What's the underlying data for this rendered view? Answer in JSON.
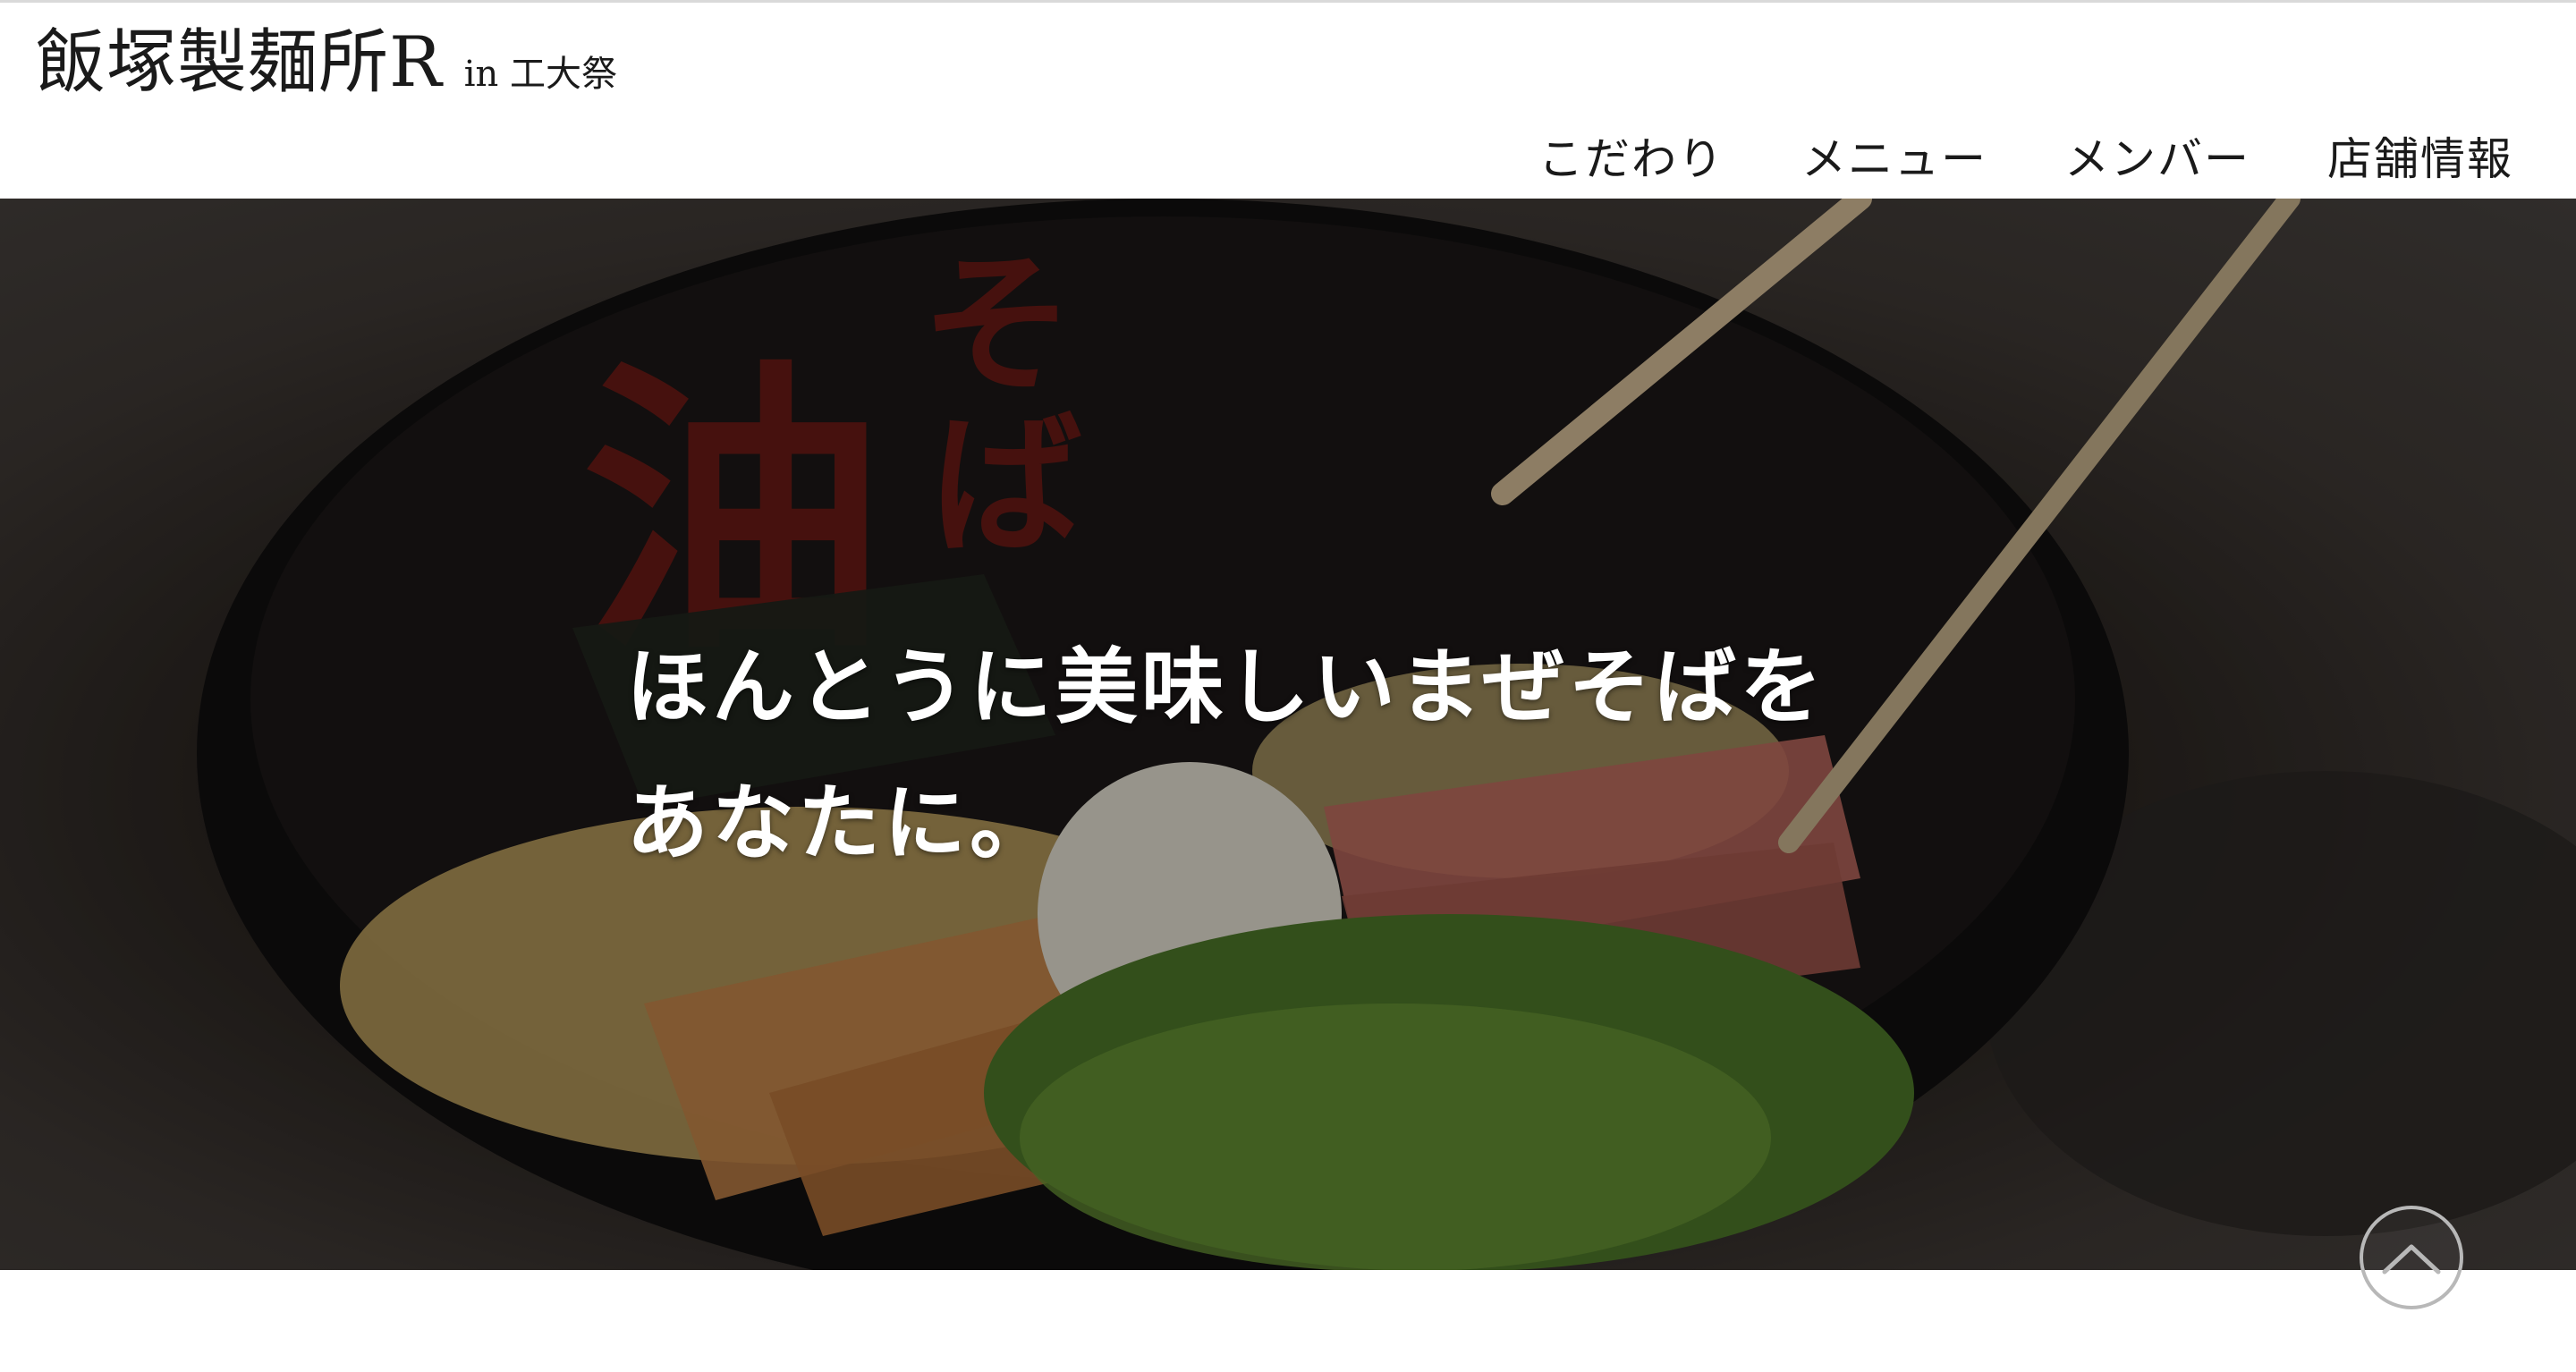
{
  "header": {
    "brand_name": "飯塚製麺所R",
    "brand_sub": "in 工大祭"
  },
  "nav": {
    "items": [
      {
        "label": "こだわり"
      },
      {
        "label": "メニュー"
      },
      {
        "label": "メンバー"
      },
      {
        "label": "店舗情報"
      }
    ]
  },
  "hero": {
    "line1": "ほんとうに美味しいまぜそばを",
    "line2": "あなたに。",
    "image_subject": "mazesoba bowl photo"
  },
  "back_to_top": {
    "icon": "chevron-up-icon"
  },
  "colors": {
    "text": "#1a1a1a",
    "hero_text": "#ffffff",
    "overlay": "rgba(0,0,0,0.35)",
    "to_top_border": "#b8b8b8"
  }
}
